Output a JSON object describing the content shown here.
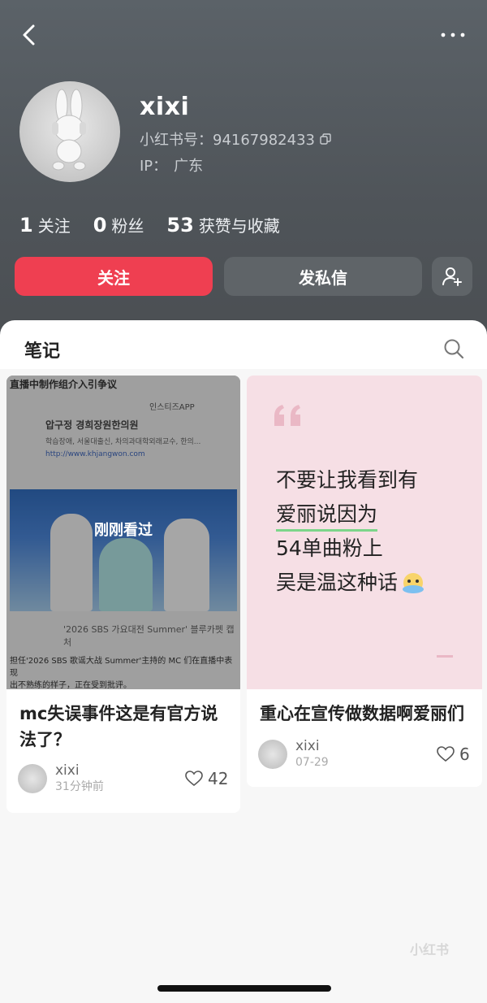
{
  "profile": {
    "name": "xixi",
    "rid_label": "小红书号：94167982433",
    "ip_label": "IP：",
    "ip_value": "广东"
  },
  "stats": [
    {
      "value": "1",
      "label": "关注"
    },
    {
      "value": "0",
      "label": "粉丝"
    },
    {
      "value": "53",
      "label": "获赞与收藏"
    }
  ],
  "actions": {
    "follow_label": "关注",
    "message_label": "发私信"
  },
  "tabs": {
    "notes_label": "笔记"
  },
  "notes": [
    {
      "title_line1": "mc失误事件这是有官方说",
      "title_line2": "法了？",
      "author": "xixi",
      "time": "31分钟前",
      "likes": "42",
      "overlay_label": "刚刚看过",
      "thumb_head": "直播中制作组介入引争议",
      "thumb_app": "인스티즈APP",
      "thumb_ad_title": "압구정 경희장원한의원",
      "thumb_ad_sub": "학습장애, 서울대출신, 차의과대학외래교수, 한의...",
      "thumb_ad_url": "http://www.khjangwon.com",
      "thumb_caption": "'2026 SBS 가요대전 Summer' 블루카펫 캡처",
      "thumb_bottom_line1": "担任'2026 SBS 歌谣大战 Summer'主持的 MC 们在直播中表现",
      "thumb_bottom_line2": "出不熟练的样子，正在受到批评。"
    },
    {
      "title": "重心在宣传做数据啊爱丽们",
      "author": "xixi",
      "time": "07-29",
      "likes": "6",
      "quote_lines": [
        "不要让我看到有",
        "爱丽说因为",
        "54单曲粉上",
        "吴是温这种话"
      ]
    }
  ],
  "watermark": "小红书",
  "colors": {
    "accent": "#ef3f51",
    "header": "#50555a",
    "quote_bg": "#f6dfe5"
  }
}
